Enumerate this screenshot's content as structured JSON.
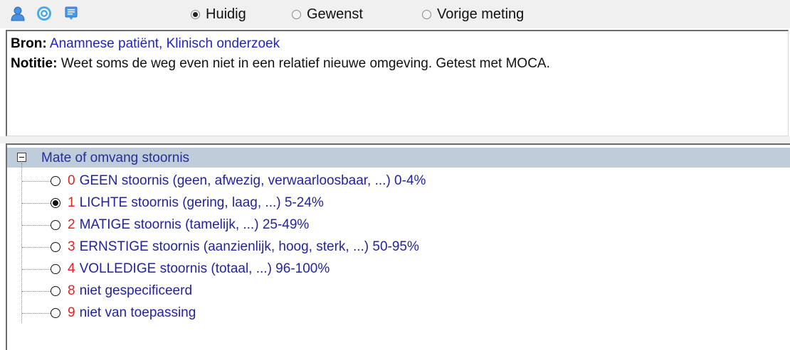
{
  "toolbar": {
    "icons": [
      "user-icon",
      "target-icon",
      "note-icon"
    ],
    "modes": [
      {
        "label": "Huidig",
        "selected": true
      },
      {
        "label": "Gewenst",
        "selected": false
      },
      {
        "label": "Vorige meting",
        "selected": false
      }
    ]
  },
  "info": {
    "source_label": "Bron:",
    "source_value": "Anamnese patiënt, Klinisch onderzoek",
    "note_label": "Notitie:",
    "note_value": "Weet soms de weg even niet in een relatief nieuwe omgeving. Getest met MOCA."
  },
  "tree": {
    "root_label": "Mate of omvang stoornis",
    "items": [
      {
        "code": "0",
        "label": "GEEN stoornis (geen, afwezig, verwaarloosbaar, ...) 0-4%",
        "selected": false
      },
      {
        "code": "1",
        "label": "LICHTE stoornis (gering, laag, ...) 5-24%",
        "selected": true
      },
      {
        "code": "2",
        "label": "MATIGE stoornis (tamelijk, ...) 25-49%",
        "selected": false
      },
      {
        "code": "3",
        "label": "ERNSTIGE stoornis (aanzienlijk, hoog, sterk, ...) 50-95%",
        "selected": false
      },
      {
        "code": "4",
        "label": "VOLLEDIGE stoornis (totaal, ...) 96-100%",
        "selected": false
      },
      {
        "code": "8",
        "label": "niet gespecificeerd",
        "selected": false
      },
      {
        "code": "9",
        "label": "niet van toepassing",
        "selected": false
      }
    ]
  },
  "colors": {
    "code": "#e82020",
    "item_text": "#2323a0",
    "source_text": "#2323c8",
    "root_highlight": "#bfcdda",
    "icon_blue": "#3b8fe0"
  }
}
